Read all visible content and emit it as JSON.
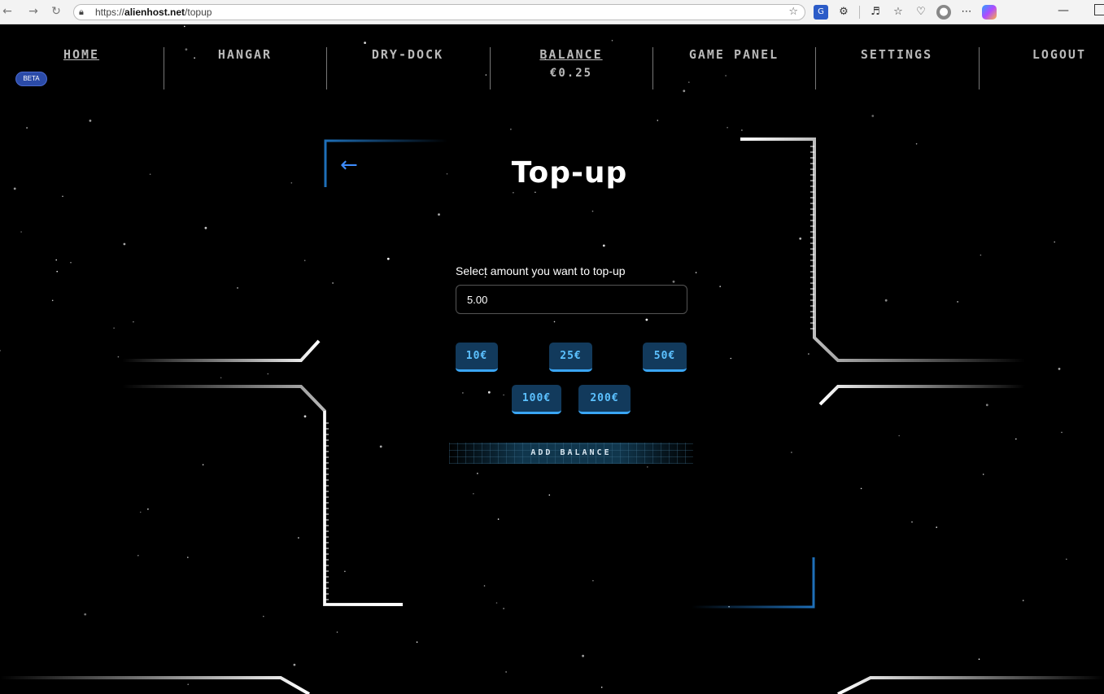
{
  "browser": {
    "url_prefix": "https://",
    "url_host": "alienhost.net",
    "url_path": "/topup"
  },
  "nav": {
    "items": [
      {
        "label": "HOME"
      },
      {
        "label": "HANGAR"
      },
      {
        "label": "DRY-DOCK"
      },
      {
        "label": "BALANCE",
        "value": "€0.25"
      },
      {
        "label": "GAME PANEL"
      },
      {
        "label": "SETTINGS"
      },
      {
        "label": "LOGOUT"
      }
    ],
    "beta_badge": "BETA"
  },
  "topup": {
    "title": "Top-up",
    "amount_label": "Select amount you want to top-up",
    "amount_value": "5.00",
    "presets": [
      "10€",
      "25€",
      "50€",
      "100€",
      "200€"
    ],
    "submit_label": "ADD BALANCE"
  },
  "colors": {
    "accent_blue": "#3d8bfa",
    "chip_bg": "#123a5c",
    "chip_text": "#5cc1ff"
  }
}
